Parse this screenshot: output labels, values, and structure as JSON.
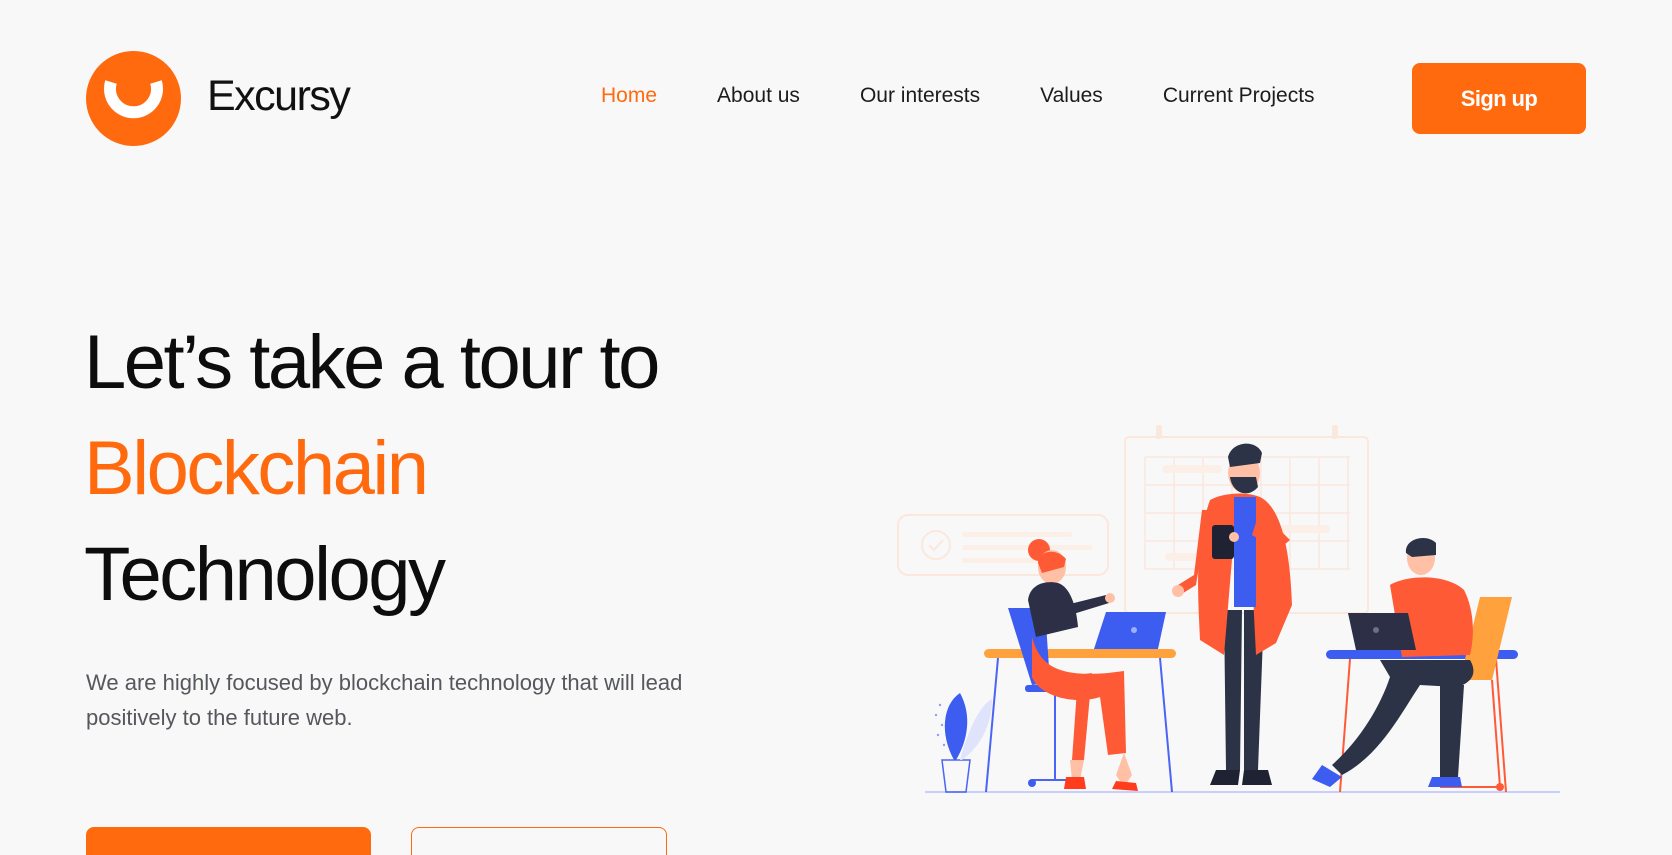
{
  "brand": {
    "name": "Excursy",
    "accent_color": "#ff6a0e"
  },
  "nav": {
    "items": [
      {
        "label": "Home",
        "active": true
      },
      {
        "label": "About us",
        "active": false
      },
      {
        "label": "Our interests",
        "active": false
      },
      {
        "label": "Values",
        "active": false
      },
      {
        "label": "Current Projects",
        "active": false
      }
    ],
    "signup_label": "Sign up"
  },
  "hero": {
    "title_line1": "Let’s take a tour to",
    "title_accent": "Blockchain",
    "title_line3": "Technology",
    "description": "We are highly focused by blockchain technology that will lead positively to the future web."
  },
  "illustration": {
    "icon": "team-working-illustration"
  }
}
